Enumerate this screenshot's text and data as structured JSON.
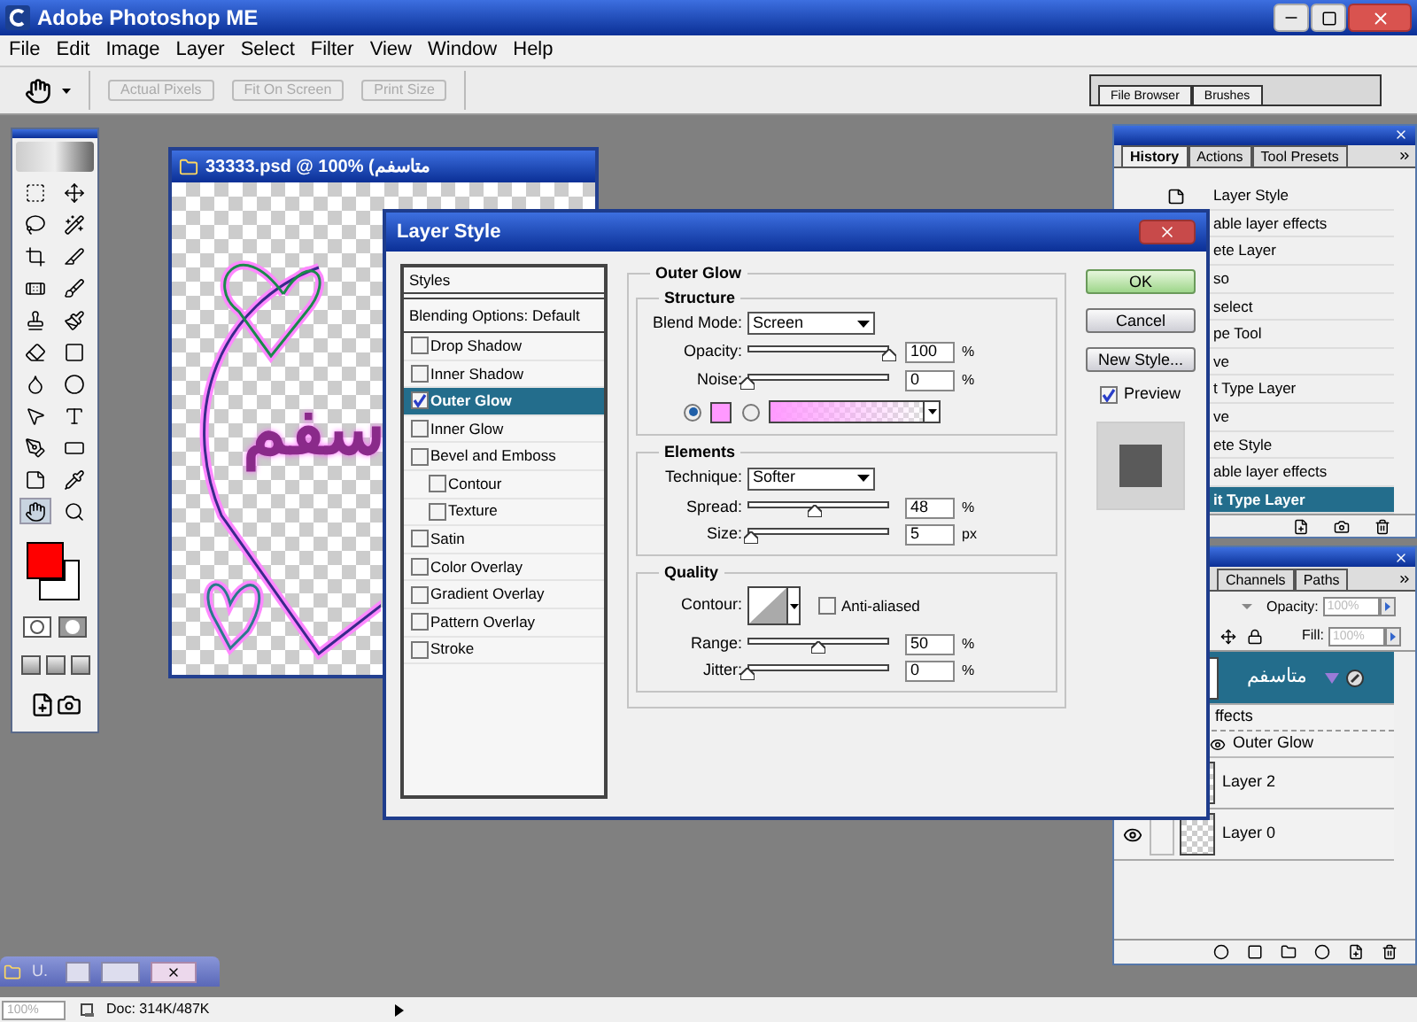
{
  "app": {
    "title": "Adobe Photoshop ME"
  },
  "menu": [
    "File",
    "Edit",
    "Image",
    "Layer",
    "Select",
    "Filter",
    "View",
    "Window",
    "Help"
  ],
  "options_bar": {
    "buttons": [
      {
        "label": "Actual Pixels",
        "disabled": true
      },
      {
        "label": "Fit On Screen",
        "disabled": true
      },
      {
        "label": "Print Size",
        "disabled": true
      }
    ]
  },
  "palette_well": {
    "tabs": [
      "File Browser",
      "Brushes"
    ]
  },
  "document": {
    "title": "33333.psd @ 100% (متاسفم",
    "canvas_text": "سفم"
  },
  "history": {
    "tabs": [
      {
        "label": "History",
        "selected": true
      },
      {
        "label": "Actions",
        "selected": false
      },
      {
        "label": "Tool Presets",
        "selected": false
      }
    ],
    "items": [
      {
        "label": "Layer Style",
        "selected": false
      },
      {
        "label": "able layer effects",
        "selected": false
      },
      {
        "label": "ete Layer",
        "selected": false
      },
      {
        "label": "so",
        "selected": false
      },
      {
        "label": "select",
        "selected": false
      },
      {
        "label": "pe Tool",
        "selected": false
      },
      {
        "label": "ve",
        "selected": false
      },
      {
        "label": "t Type Layer",
        "selected": false
      },
      {
        "label": "ve",
        "selected": false
      },
      {
        "label": "ete Style",
        "selected": false
      },
      {
        "label": "able layer effects",
        "selected": false
      },
      {
        "label": "it Type Layer",
        "selected": true
      }
    ]
  },
  "layers": {
    "tabs": [
      {
        "label": "Channels",
        "selected": false
      },
      {
        "label": "Paths",
        "selected": false
      }
    ],
    "opacity_label": "Opacity:",
    "opacity": "100%",
    "fill_label": "Fill:",
    "fill": "100%",
    "rows": [
      {
        "kind": "text_layer",
        "name": "متاسفم",
        "selected": true
      },
      {
        "kind": "effects",
        "name": "ffects",
        "selected": false
      },
      {
        "kind": "effect",
        "name": "Outer Glow",
        "selected": false
      },
      {
        "kind": "layer",
        "name": "Layer 2",
        "selected": false
      },
      {
        "kind": "layer",
        "name": "Layer 0",
        "selected": false
      }
    ]
  },
  "layer_style": {
    "title": "Layer Style",
    "styles_header": "Styles",
    "blending": "Blending Options: Default",
    "effects": [
      {
        "label": "Drop Shadow",
        "checked": false,
        "selected": false
      },
      {
        "label": "Inner Shadow",
        "checked": false,
        "selected": false
      },
      {
        "label": "Outer Glow",
        "checked": true,
        "selected": true
      },
      {
        "label": "Inner Glow",
        "checked": false,
        "selected": false
      },
      {
        "label": "Bevel and Emboss",
        "checked": false,
        "selected": false,
        "children": [
          {
            "label": "Contour",
            "checked": false,
            "selected": false
          },
          {
            "label": "Texture",
            "checked": false,
            "selected": false
          }
        ]
      },
      {
        "label": "Satin",
        "checked": false,
        "selected": false
      },
      {
        "label": "Color Overlay",
        "checked": false,
        "selected": false
      },
      {
        "label": "Gradient Overlay",
        "checked": false,
        "selected": false
      },
      {
        "label": "Pattern Overlay",
        "checked": false,
        "selected": false
      },
      {
        "label": "Stroke",
        "checked": false,
        "selected": false
      }
    ],
    "outer_glow": {
      "title": "Outer Glow",
      "structure": {
        "title": "Structure",
        "blend_mode_label": "Blend Mode:",
        "blend_mode": "Screen",
        "opacity": {
          "label": "Opacity:",
          "value": "100",
          "unit": "%",
          "level": 1
        },
        "noise": {
          "label": "Noise:",
          "value": "0",
          "unit": "%",
          "level": 0
        },
        "sources": [
          {
            "kind": "color",
            "selected": true,
            "color": "#ff99ff"
          },
          {
            "kind": "gradient",
            "selected": false,
            "color": "#ff99ff"
          }
        ]
      },
      "elements": {
        "title": "Elements",
        "technique_label": "Technique:",
        "technique": "Softer",
        "spread": {
          "label": "Spread:",
          "value": "48",
          "unit": "%",
          "level": 0.48
        },
        "size": {
          "label": "Size:",
          "value": "5",
          "unit": "px",
          "level": 0.02
        }
      },
      "quality": {
        "title": "Quality",
        "contour_label": "Contour:",
        "anti_aliased": {
          "label": "Anti-aliased",
          "checked": false
        },
        "range": {
          "label": "Range:",
          "value": "50",
          "unit": "%",
          "level": 0.5
        },
        "jitter": {
          "label": "Jitter:",
          "value": "0",
          "unit": "%",
          "level": 0
        }
      }
    },
    "buttons": [
      {
        "label": "OK",
        "kind": "default"
      },
      {
        "label": "Cancel",
        "kind": "normal"
      },
      {
        "label": "New Style...",
        "kind": "normal"
      }
    ],
    "preview": {
      "label": "Preview",
      "checked": true
    }
  },
  "taskbar": {
    "label": "U."
  },
  "status_bar": {
    "zoom": "100%",
    "doc": "Doc: 314K/487K"
  }
}
